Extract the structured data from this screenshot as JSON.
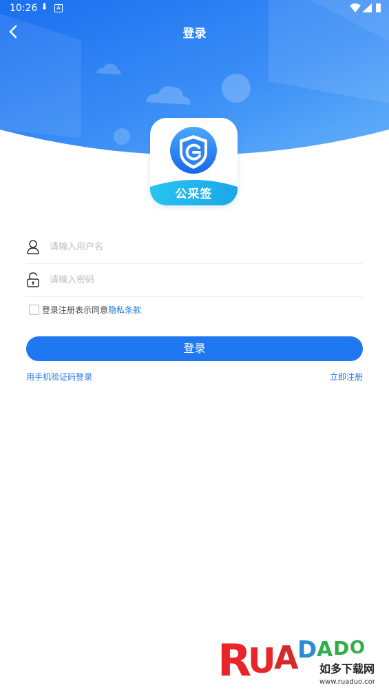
{
  "status_bar": {
    "time": "10:26",
    "notif_letter": "A"
  },
  "header": {
    "title": "登录"
  },
  "logo": {
    "app_name": "公采签"
  },
  "form": {
    "username_placeholder": "请输入用户名",
    "password_placeholder": "请输入密码",
    "agreement_text": "登录注册表示同意",
    "agreement_link": "隐私条款",
    "login_button": "登录"
  },
  "links": {
    "sms_login": "用手机验证码登录",
    "register": "立即注册"
  },
  "watermark": {
    "brand": "RUANDUO",
    "cn": "如多下载网",
    "url": "www.ruaduo.com"
  },
  "colors": {
    "primary": "#1f78f2",
    "header_top": "#1a6ff0",
    "header_bottom": "#5aaaf8"
  }
}
